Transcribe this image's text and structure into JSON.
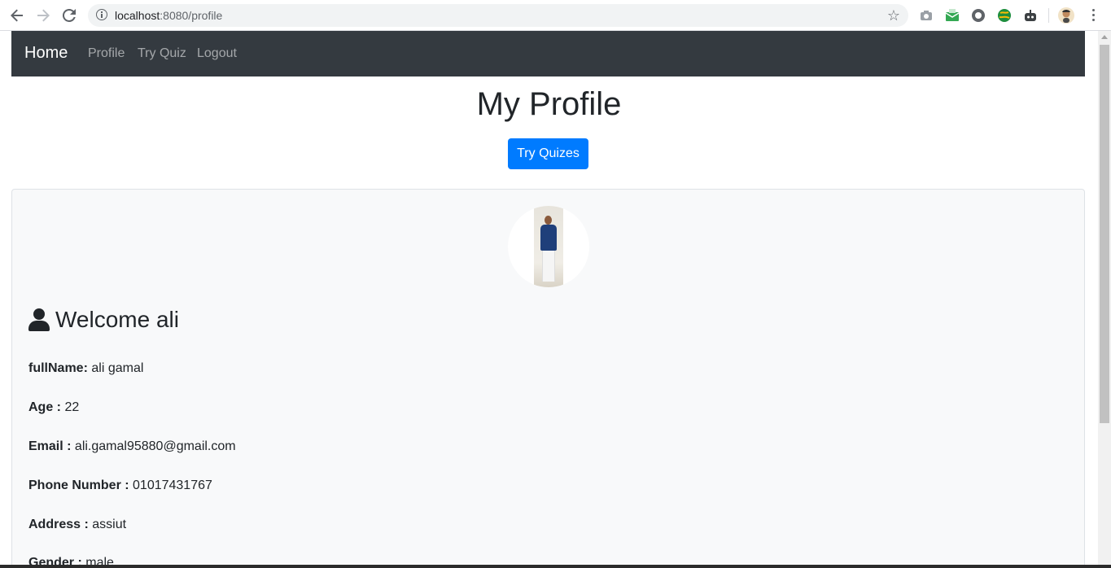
{
  "browser": {
    "url_host": "localhost",
    "url_path": ":8080/profile"
  },
  "navbar": {
    "brand": "Home",
    "links": [
      "Profile",
      "Try Quiz",
      "Logout"
    ]
  },
  "page": {
    "title": "My Profile",
    "cta": "Try Quizes"
  },
  "profile": {
    "welcome": "Welcome ali",
    "fields": [
      {
        "label": "fullName:",
        "value": "ali gamal"
      },
      {
        "label": "Age :",
        "value": "22"
      },
      {
        "label": "Email :",
        "value": "ali.gamal95880@gmail.com"
      },
      {
        "label": "Phone Number :",
        "value": "01017431767"
      },
      {
        "label": "Address :",
        "value": "assiut"
      },
      {
        "label": "Gender :",
        "value": "male"
      }
    ]
  },
  "icons": {
    "back": "arrow-left-icon",
    "forward": "arrow-right-icon",
    "reload": "reload-icon",
    "info": "info-icon",
    "bookmark": "star-icon",
    "user": "user-icon"
  },
  "colors": {
    "navbar_bg": "#343a40",
    "primary": "#007bff",
    "card_bg": "#f8f9fa"
  }
}
